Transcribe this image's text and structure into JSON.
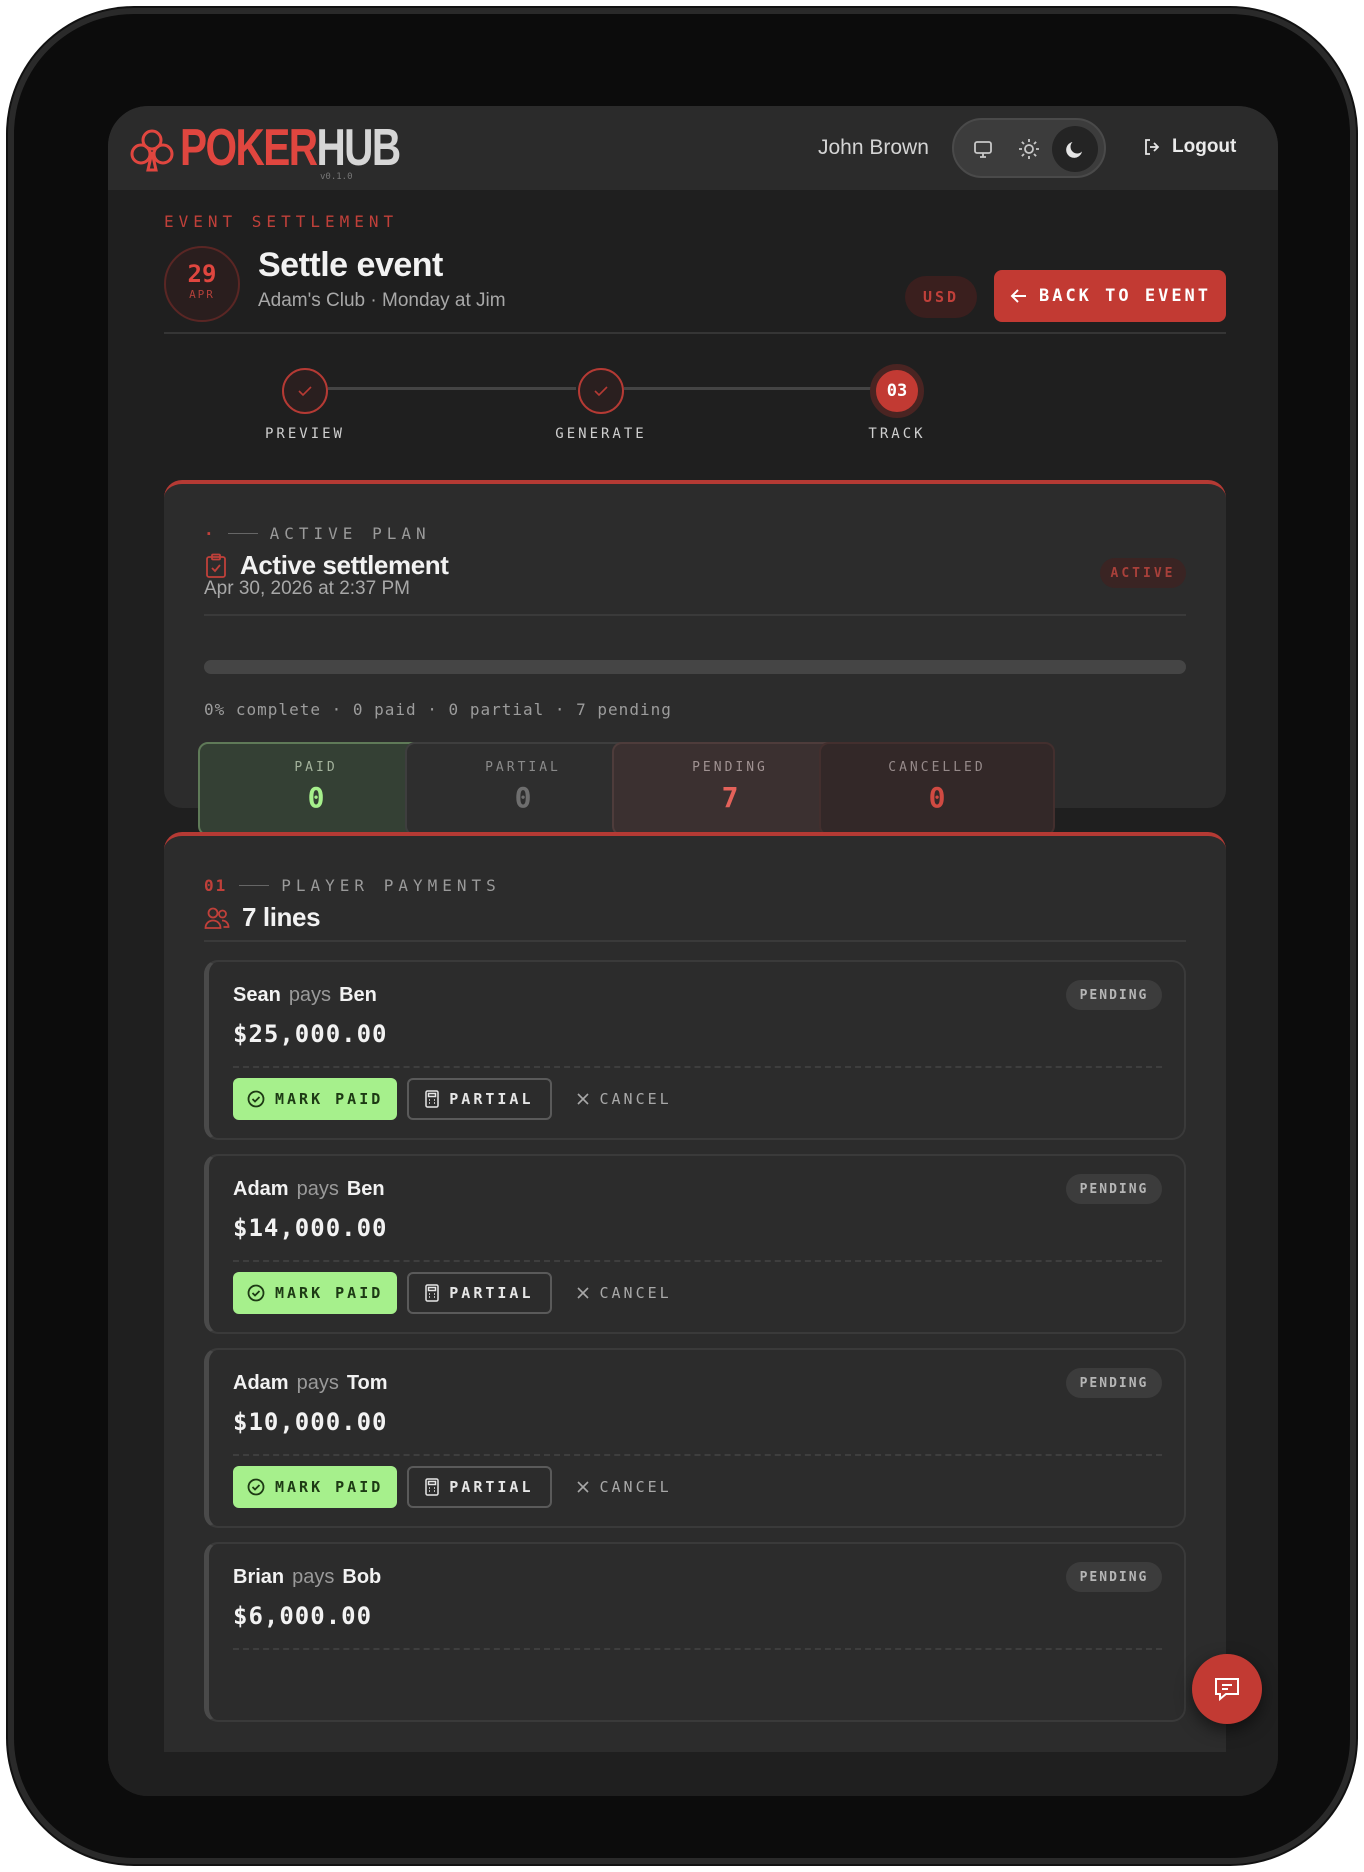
{
  "app": {
    "brand_primary": "POKER",
    "brand_secondary": "HUB",
    "version": "v0.1.0",
    "accent_color": "#c23a33",
    "success_color": "#a6f08c"
  },
  "topbar": {
    "user_name": "John Brown",
    "theme_options": [
      "monitor-icon",
      "sun-icon",
      "moon-icon"
    ],
    "theme_active": "moon-icon",
    "logout_label": "Logout"
  },
  "header": {
    "eyebrow": "EVENT SETTLEMENT",
    "date_day": "29",
    "date_month": "APR",
    "title": "Settle event",
    "subtitle": "Adam's Club · Monday at Jim",
    "currency": "USD",
    "back_label": "BACK TO EVENT"
  },
  "stepper": {
    "steps": [
      {
        "label": "PREVIEW",
        "state": "done",
        "mark": ""
      },
      {
        "label": "GENERATE",
        "state": "done",
        "mark": ""
      },
      {
        "label": "TRACK",
        "state": "current",
        "mark": "03"
      }
    ]
  },
  "active_plan": {
    "eyebrow_marker": "·",
    "eyebrow": "ACTIVE PLAN",
    "title": "Active settlement",
    "timestamp": "Apr 30, 2026 at 2:37 PM",
    "status": "ACTIVE",
    "progress_fraction": 0,
    "progress_text": "0% complete · 0 paid · 0 partial · 7 pending",
    "stats": [
      {
        "label": "PAID",
        "value": "0"
      },
      {
        "label": "PARTIAL",
        "value": "0"
      },
      {
        "label": "PENDING",
        "value": "7"
      },
      {
        "label": "CANCELLED",
        "value": "0"
      }
    ]
  },
  "payments": {
    "eyebrow_num": "01",
    "eyebrow": "PLAYER PAYMENTS",
    "title": "7 lines",
    "pays_word": "pays",
    "mark_paid_label": "MARK PAID",
    "partial_label": "PARTIAL",
    "cancel_label": "CANCEL",
    "lines": [
      {
        "from": "Sean",
        "to": "Ben",
        "amount": "$25,000.00",
        "status": "PENDING"
      },
      {
        "from": "Adam",
        "to": "Ben",
        "amount": "$14,000.00",
        "status": "PENDING"
      },
      {
        "from": "Adam",
        "to": "Tom",
        "amount": "$10,000.00",
        "status": "PENDING"
      },
      {
        "from": "Brian",
        "to": "Bob",
        "amount": "$6,000.00",
        "status": "PENDING"
      }
    ]
  }
}
